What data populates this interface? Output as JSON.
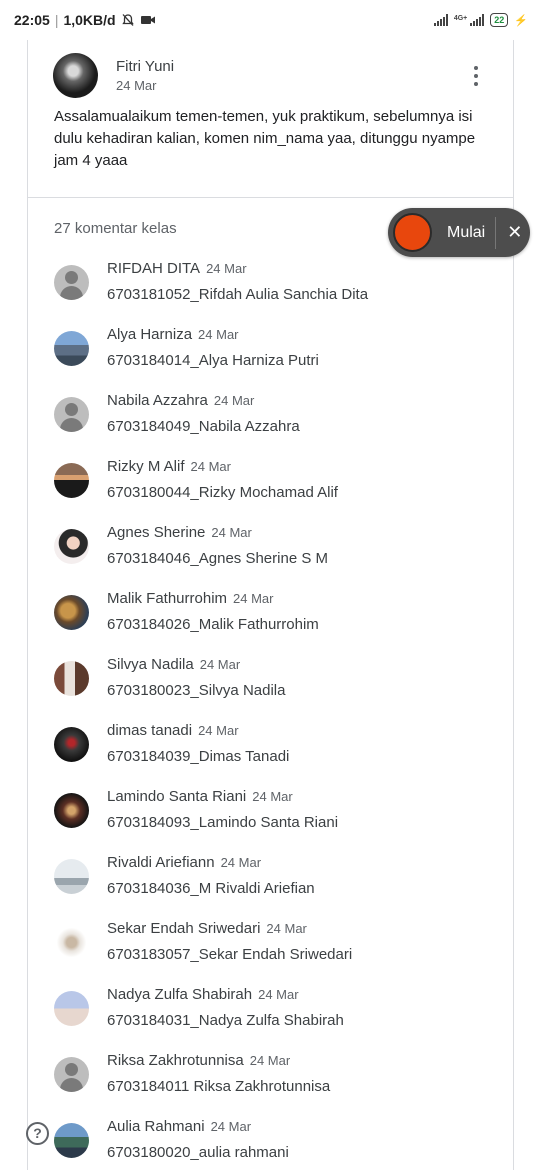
{
  "status_bar": {
    "time": "22:05",
    "speed": "1,0KB/d",
    "network": "4G+",
    "battery": "22"
  },
  "post": {
    "author": "Fitri Yuni",
    "date": "24 Mar",
    "text": "Assalamualaikum temen-temen, yuk praktikum, sebelumnya isi dulu kehadiran kalian, komen nim_nama yaa, ditunggu nyampe jam 4 yaaa"
  },
  "comments_count": "27 komentar kelas",
  "recorder": {
    "label": "Mulai",
    "close": "✕",
    "accent": "#e8470d"
  },
  "help_label": "?",
  "comments": [
    {
      "name": "RIFDAH DITA",
      "date": "24 Mar",
      "text": "6703181052_Rifdah Aulia Sanchia Dita",
      "avatar": "default"
    },
    {
      "name": "Alya Harniza",
      "date": "24 Mar",
      "text": "6703184014_Alya Harniza Putri",
      "avatar": "photo"
    },
    {
      "name": "Nabila Azzahra",
      "date": "24 Mar",
      "text": "6703184049_Nabila Azzahra",
      "avatar": "default"
    },
    {
      "name": "Rizky M Alif",
      "date": "24 Mar",
      "text": "6703180044_Rizky Mochamad Alif",
      "avatar": "photo"
    },
    {
      "name": "Agnes Sherine",
      "date": "24 Mar",
      "text": "6703184046_Agnes Sherine S M",
      "avatar": "photo"
    },
    {
      "name": "Malik Fathurrohim",
      "date": "24 Mar",
      "text": "6703184026_Malik Fathurrohim",
      "avatar": "photo"
    },
    {
      "name": "Silvya Nadila",
      "date": "24 Mar",
      "text": "6703180023_Silvya Nadila",
      "avatar": "photo"
    },
    {
      "name": "dimas tanadi",
      "date": "24 Mar",
      "text": "6703184039_Dimas Tanadi",
      "avatar": "photo"
    },
    {
      "name": "Lamindo Santa Riani",
      "date": "24 Mar",
      "text": "6703184093_Lamindo Santa Riani",
      "avatar": "photo"
    },
    {
      "name": "Rivaldi Ariefiann",
      "date": "24 Mar",
      "text": "6703184036_M Rivaldi Ariefian",
      "avatar": "photo"
    },
    {
      "name": "Sekar Endah Sriwedari",
      "date": "24 Mar",
      "text": "6703183057_Sekar Endah Sriwedari",
      "avatar": "photo"
    },
    {
      "name": "Nadya Zulfa Shabirah",
      "date": "24 Mar",
      "text": "6703184031_Nadya Zulfa Shabirah",
      "avatar": "photo"
    },
    {
      "name": "Riksa Zakhrotunnisa",
      "date": "24 Mar",
      "text": "6703184011 Riksa Zakhrotunnisa",
      "avatar": "default"
    },
    {
      "name": "Aulia Rahmani",
      "date": "24 Mar",
      "text": "6703180020_aulia rahmani",
      "avatar": "photo"
    }
  ]
}
